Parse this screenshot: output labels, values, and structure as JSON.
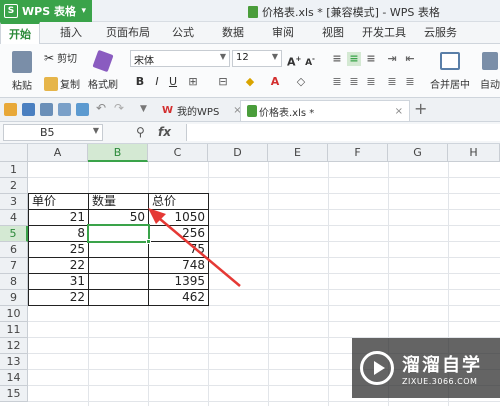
{
  "titlebar": {
    "app_name": "WPS 表格",
    "document_title": "价格表.xls * [兼容模式] - WPS 表格"
  },
  "menu": {
    "tabs": [
      "开始",
      "插入",
      "页面布局",
      "公式",
      "数据",
      "审阅",
      "视图",
      "开发工具",
      "云服务"
    ]
  },
  "ribbon": {
    "paste_label": "粘贴",
    "cut_label": "剪切",
    "copy_label": "复制",
    "format_painter_label": "格式刷",
    "font_name": "宋体",
    "font_size": "12",
    "bold": "B",
    "italic": "I",
    "underline": "U",
    "merge_label": "合并居中",
    "auto_wrap_label": "自动"
  },
  "quickbar": {
    "tab_wps": "我的WPS",
    "tab_doc": "价格表.xls *"
  },
  "formula_bar": {
    "cell_ref": "B5",
    "fx": "fx",
    "content": ""
  },
  "sheet": {
    "columns": [
      "A",
      "B",
      "C",
      "D",
      "E",
      "F",
      "G",
      "H"
    ],
    "rows": [
      "1",
      "2",
      "3",
      "4",
      "5",
      "6",
      "7",
      "8",
      "9",
      "10",
      "11",
      "12",
      "13",
      "14",
      "15"
    ],
    "active_col": "B",
    "active_row": "5",
    "headers": {
      "a3": "单价",
      "b3": "数量",
      "c3": "总价"
    },
    "unit_price": [
      "21",
      "8",
      "25",
      "22",
      "31",
      "22"
    ],
    "quantity": [
      "50",
      "",
      "",
      "",
      "",
      ""
    ],
    "total": [
      "1050",
      "256",
      "75",
      "748",
      "1395",
      "462"
    ]
  },
  "watermark": {
    "name": "溜溜自学",
    "url": "ZIXUE.3066.COM"
  },
  "colors": {
    "accent": "#3aa34a",
    "arrow": "#e53935"
  }
}
